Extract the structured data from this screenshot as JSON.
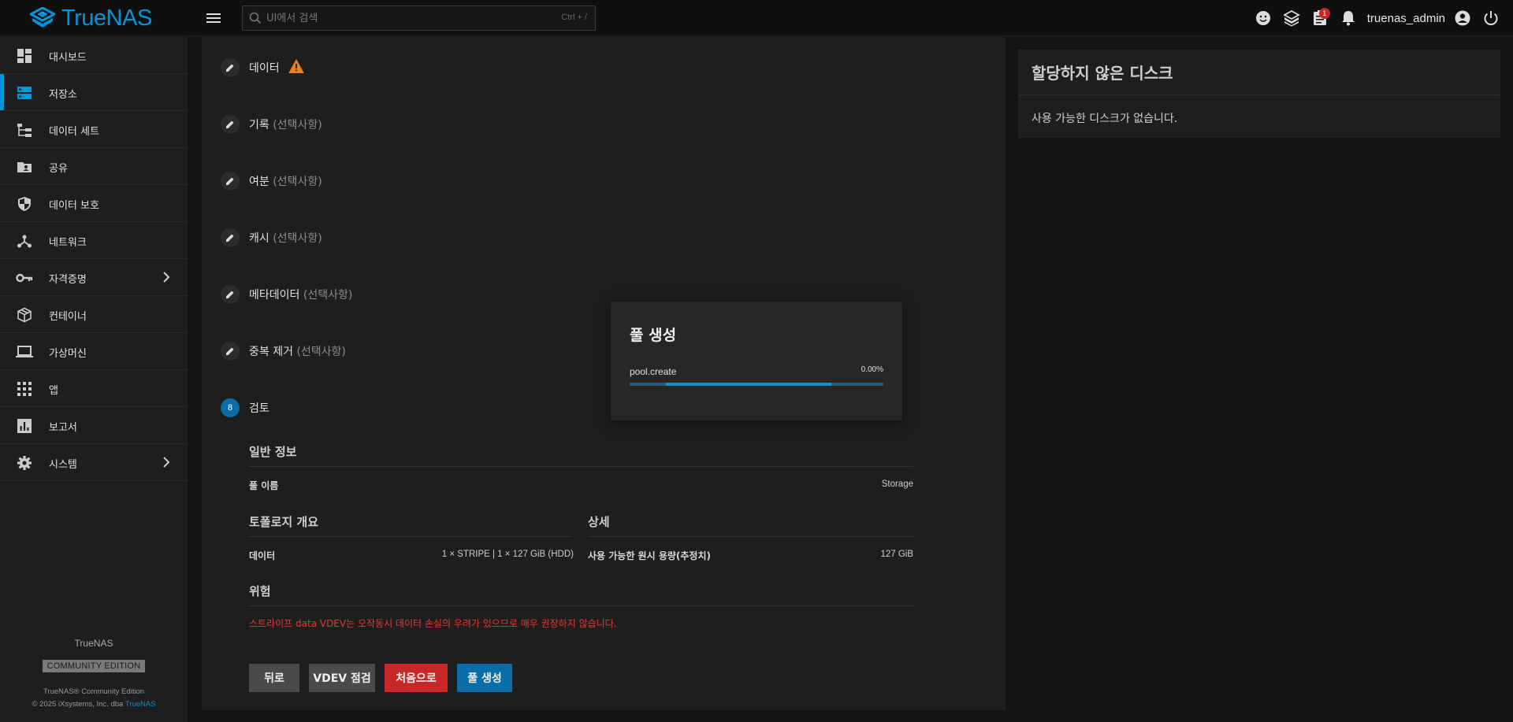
{
  "brand": {
    "name": "TrueNAS",
    "accent": "#0095d5"
  },
  "search": {
    "placeholder": "UI에서 검색",
    "shortcut": "Ctrl + /"
  },
  "topbar": {
    "icons": [
      "feedback-icon",
      "truecommand-icon",
      "jobs-icon",
      "notifications-icon",
      "account-icon",
      "power-icon"
    ],
    "jobs_badge": "1",
    "username": "truenas_admin"
  },
  "sidebar": {
    "items": [
      {
        "label": "대시보드",
        "icon": "dashboard-icon"
      },
      {
        "label": "저장소",
        "icon": "storage-icon",
        "active": true
      },
      {
        "label": "데이터 세트",
        "icon": "datasets-icon"
      },
      {
        "label": "공유",
        "icon": "shares-icon"
      },
      {
        "label": "데이터 보호",
        "icon": "data-protection-icon"
      },
      {
        "label": "네트워크",
        "icon": "network-icon"
      },
      {
        "label": "자격증명",
        "icon": "credentials-icon",
        "expandable": true
      },
      {
        "label": "컨테이너",
        "icon": "containers-icon"
      },
      {
        "label": "가상머신",
        "icon": "virtual-machines-icon"
      },
      {
        "label": "앱",
        "icon": "apps-icon"
      },
      {
        "label": "보고서",
        "icon": "reports-icon"
      },
      {
        "label": "시스템",
        "icon": "system-icon",
        "expandable": true
      }
    ],
    "footer": {
      "title": "TrueNAS",
      "edition": "COMMUNITY EDITION",
      "copyright_line1": "TrueNAS® Community Edition",
      "copyright_line2": "© 2025 iXsystems, Inc. dba",
      "copyright_link": "TrueNAS"
    }
  },
  "wizard": {
    "steps": [
      {
        "label": "데이터",
        "optional": "",
        "warning": true
      },
      {
        "label": "기록",
        "optional": "(선택사항)"
      },
      {
        "label": "여분",
        "optional": "(선택사항)"
      },
      {
        "label": "캐시",
        "optional": "(선택사항)"
      },
      {
        "label": "메타데이터",
        "optional": "(선택사항)"
      },
      {
        "label": "중복 제거",
        "optional": "(선택사항)"
      }
    ],
    "review": {
      "step_number": "8",
      "label": "검토",
      "general_title": "일반 정보",
      "pool_name_key": "풀 이름",
      "pool_name_value": "Storage",
      "topology_title": "토폴로지 개요",
      "data_key": "데이터",
      "data_value": "1 × STRIPE | 1 × 127 GiB (HDD)",
      "details_title": "상세",
      "capacity_key": "사용 가능한 원시 용량(추정치)",
      "capacity_value": "127 GiB",
      "danger_title": "위험",
      "danger_text": "스트라이프 data VDEV는 오작동시 데이터 손실의 우려가 있으므로 매우 권장하지 않습니다."
    },
    "buttons": {
      "back": "뒤로",
      "inspect": "VDEV 점검",
      "reset": "처음으로",
      "create": "풀 생성"
    }
  },
  "unassigned": {
    "title": "할당하지 않은 디스크",
    "message": "사용 가능한 디스크가 없습니다."
  },
  "modal": {
    "title": "풀 생성",
    "task": "pool.create",
    "percent": "0.00%",
    "progress_fraction": 0.0
  }
}
